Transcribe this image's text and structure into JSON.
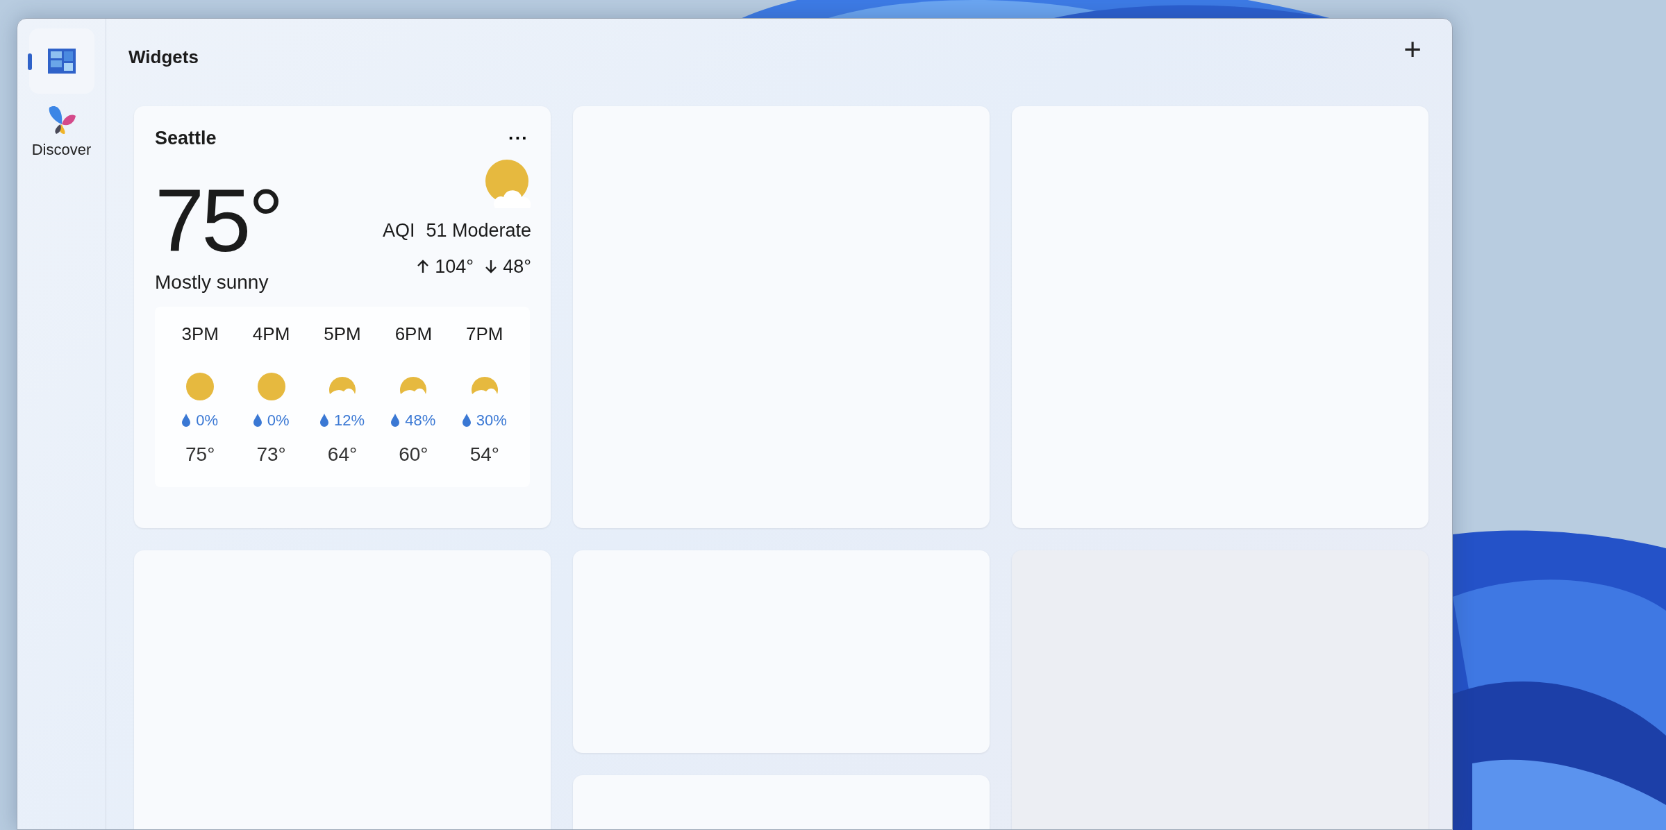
{
  "sidebar": {
    "items": [
      {
        "kind": "widgets",
        "selected": true
      },
      {
        "kind": "discover",
        "label": "Discover",
        "selected": false
      }
    ]
  },
  "header": {
    "title": "Widgets",
    "add_symbol": "+"
  },
  "weather": {
    "city": "Seattle",
    "more": "···",
    "temperature": "75°",
    "condition": "Mostly sunny",
    "aqi_label": "AQI",
    "aqi_value": "51 Moderate",
    "high": "104°",
    "low": "48°",
    "hourly": [
      {
        "time": "3PM",
        "kind": "sunny",
        "precip": "0%",
        "temp": "75°"
      },
      {
        "time": "4PM",
        "kind": "sunny",
        "precip": "0%",
        "temp": "73°"
      },
      {
        "time": "5PM",
        "kind": "partly",
        "precip": "12%",
        "temp": "64°"
      },
      {
        "time": "6PM",
        "kind": "partly",
        "precip": "48%",
        "temp": "60°"
      },
      {
        "time": "7PM",
        "kind": "partly",
        "precip": "30%",
        "temp": "54°"
      }
    ]
  },
  "columns": [
    [
      {
        "kind": "weather"
      },
      {
        "kind": "tall"
      }
    ],
    [
      {
        "kind": "tall"
      },
      {
        "kind": "short"
      },
      {
        "kind": "tall"
      }
    ],
    [
      {
        "kind": "tall"
      },
      {
        "kind": "shaded"
      }
    ]
  ]
}
